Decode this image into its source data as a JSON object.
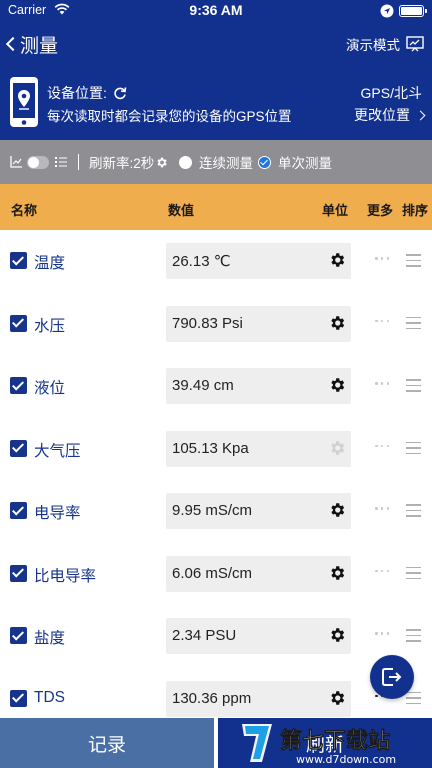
{
  "status_bar": {
    "carrier": "Carrier",
    "time": "9:36 AM"
  },
  "nav": {
    "back_title": "测量",
    "demo_label": "演示模式"
  },
  "location": {
    "label": "设备位置:",
    "description": "每次读取时都会记录您的设备的GPS位置",
    "gps_mode": "GPS/北斗",
    "change_label": "更改位置"
  },
  "controls": {
    "refresh_rate": "刷新率:2秒",
    "continuous_label": "连续测量",
    "single_label": "单次测量",
    "selected_mode": "单次测量"
  },
  "table": {
    "headers": {
      "name": "名称",
      "value": "数值",
      "unit": "单位",
      "more": "更多",
      "sort": "排序"
    },
    "rows": [
      {
        "name": "温度",
        "value": "26.13 ℃",
        "checked": true,
        "gear_enabled": true
      },
      {
        "name": "水压",
        "value": "790.83 Psi",
        "checked": true,
        "gear_enabled": true
      },
      {
        "name": "液位",
        "value": "39.49 cm",
        "checked": true,
        "gear_enabled": true
      },
      {
        "name": "大气压",
        "value": "105.13 Kpa",
        "checked": true,
        "gear_enabled": false
      },
      {
        "name": "电导率",
        "value": "9.95 mS/cm",
        "checked": true,
        "gear_enabled": true
      },
      {
        "name": "比电导率",
        "value": "6.06 mS/cm",
        "checked": true,
        "gear_enabled": true
      },
      {
        "name": "盐度",
        "value": "2.34 PSU",
        "checked": true,
        "gear_enabled": true
      },
      {
        "name": "TDS",
        "value": "130.36 ppm",
        "checked": true,
        "gear_enabled": true
      }
    ]
  },
  "bottom": {
    "record_label": "记录",
    "refresh_label": "刷新"
  },
  "watermark": {
    "text": "第七下载站",
    "url": "www.d7down.com"
  },
  "colors": {
    "primary": "#12308e",
    "header": "#f0ad4e",
    "control_bar": "#8e8e93",
    "record_button": "#4a6fa5"
  }
}
